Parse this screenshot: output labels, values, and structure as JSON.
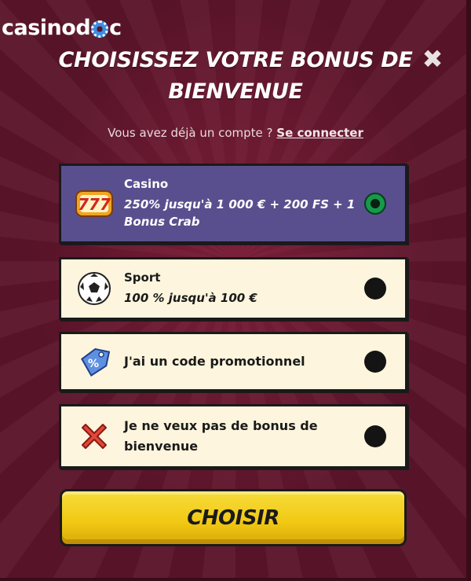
{
  "logo": {
    "text_left": "casino",
    "text_right": "c"
  },
  "header": {
    "title": "CHOISISSEZ VOTRE BONUS DE BIENVENUE",
    "close_symbol": "✖"
  },
  "login": {
    "prompt": "Vous avez déjà un compte ?",
    "link": "Se connecter"
  },
  "options": [
    {
      "category": "Casino",
      "description": "250% jusqu'à 1 000 € + 200 FS + 1 Bonus Crab",
      "icon": "slot-777-icon",
      "selected": true
    },
    {
      "category": "Sport",
      "description": "100 % jusqu'à 100 €",
      "icon": "soccer-ball-icon",
      "selected": false
    },
    {
      "label": "J'ai un code promotionnel",
      "icon": "promo-tag-icon",
      "selected": false
    },
    {
      "label": "Je ne veux pas de bonus de bienvenue",
      "icon": "red-x-icon",
      "selected": false
    }
  ],
  "cta": {
    "label": "CHOISIR"
  },
  "colors": {
    "background": "#5a1429",
    "selected_option": "#5a4f8e",
    "option": "#fdf5dd",
    "button": "#f1c813",
    "radio_selected": "#159a4a"
  }
}
